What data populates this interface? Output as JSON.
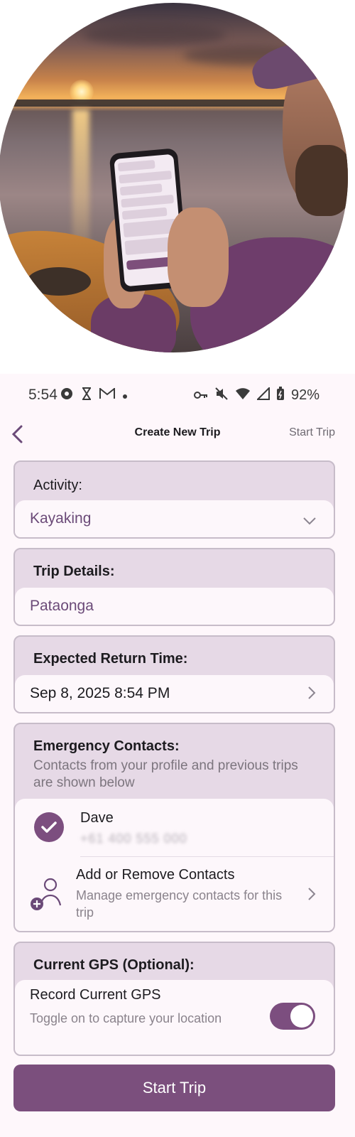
{
  "status_bar": {
    "time": "5:54",
    "left_icons": [
      "settings-icon",
      "hourglass-icon",
      "mail-icon",
      "dot-icon"
    ],
    "right_icons": [
      "key-icon",
      "mute-icon",
      "wifi-icon",
      "signal-icon",
      "battery-icon"
    ],
    "battery": "92%"
  },
  "topbar": {
    "back_icon": "chevron-left-icon",
    "title": "Create New Trip",
    "action": "Start Trip"
  },
  "activity": {
    "label": "Activity:",
    "value": "Kayaking",
    "icon": "chevron-down-icon"
  },
  "trip_details": {
    "label": "Trip Details:",
    "value": "Pataonga"
  },
  "return_time": {
    "label": "Expected Return Time:",
    "value": "Sep 8, 2025 8:54 PM",
    "icon": "chevron-right-icon"
  },
  "emergency": {
    "label": "Emergency Contacts:",
    "sublabel": "Contacts from your profile and previous trips are shown below",
    "contacts": [
      {
        "name": "Dave",
        "phone": "+61 400 555 000",
        "selected": true
      }
    ],
    "manage": {
      "title": "Add or Remove Contacts",
      "subtitle": "Manage emergency contacts for this trip"
    }
  },
  "gps": {
    "label": "Current GPS (Optional):",
    "toggle_title": "Record Current GPS",
    "toggle_subtitle": "Toggle on to capture your location",
    "enabled": true
  },
  "primary_button": "Start Trip",
  "colors": {
    "accent": "#7b4f7d",
    "card_header": "#e6d9e6",
    "background": "#fef7fb"
  }
}
